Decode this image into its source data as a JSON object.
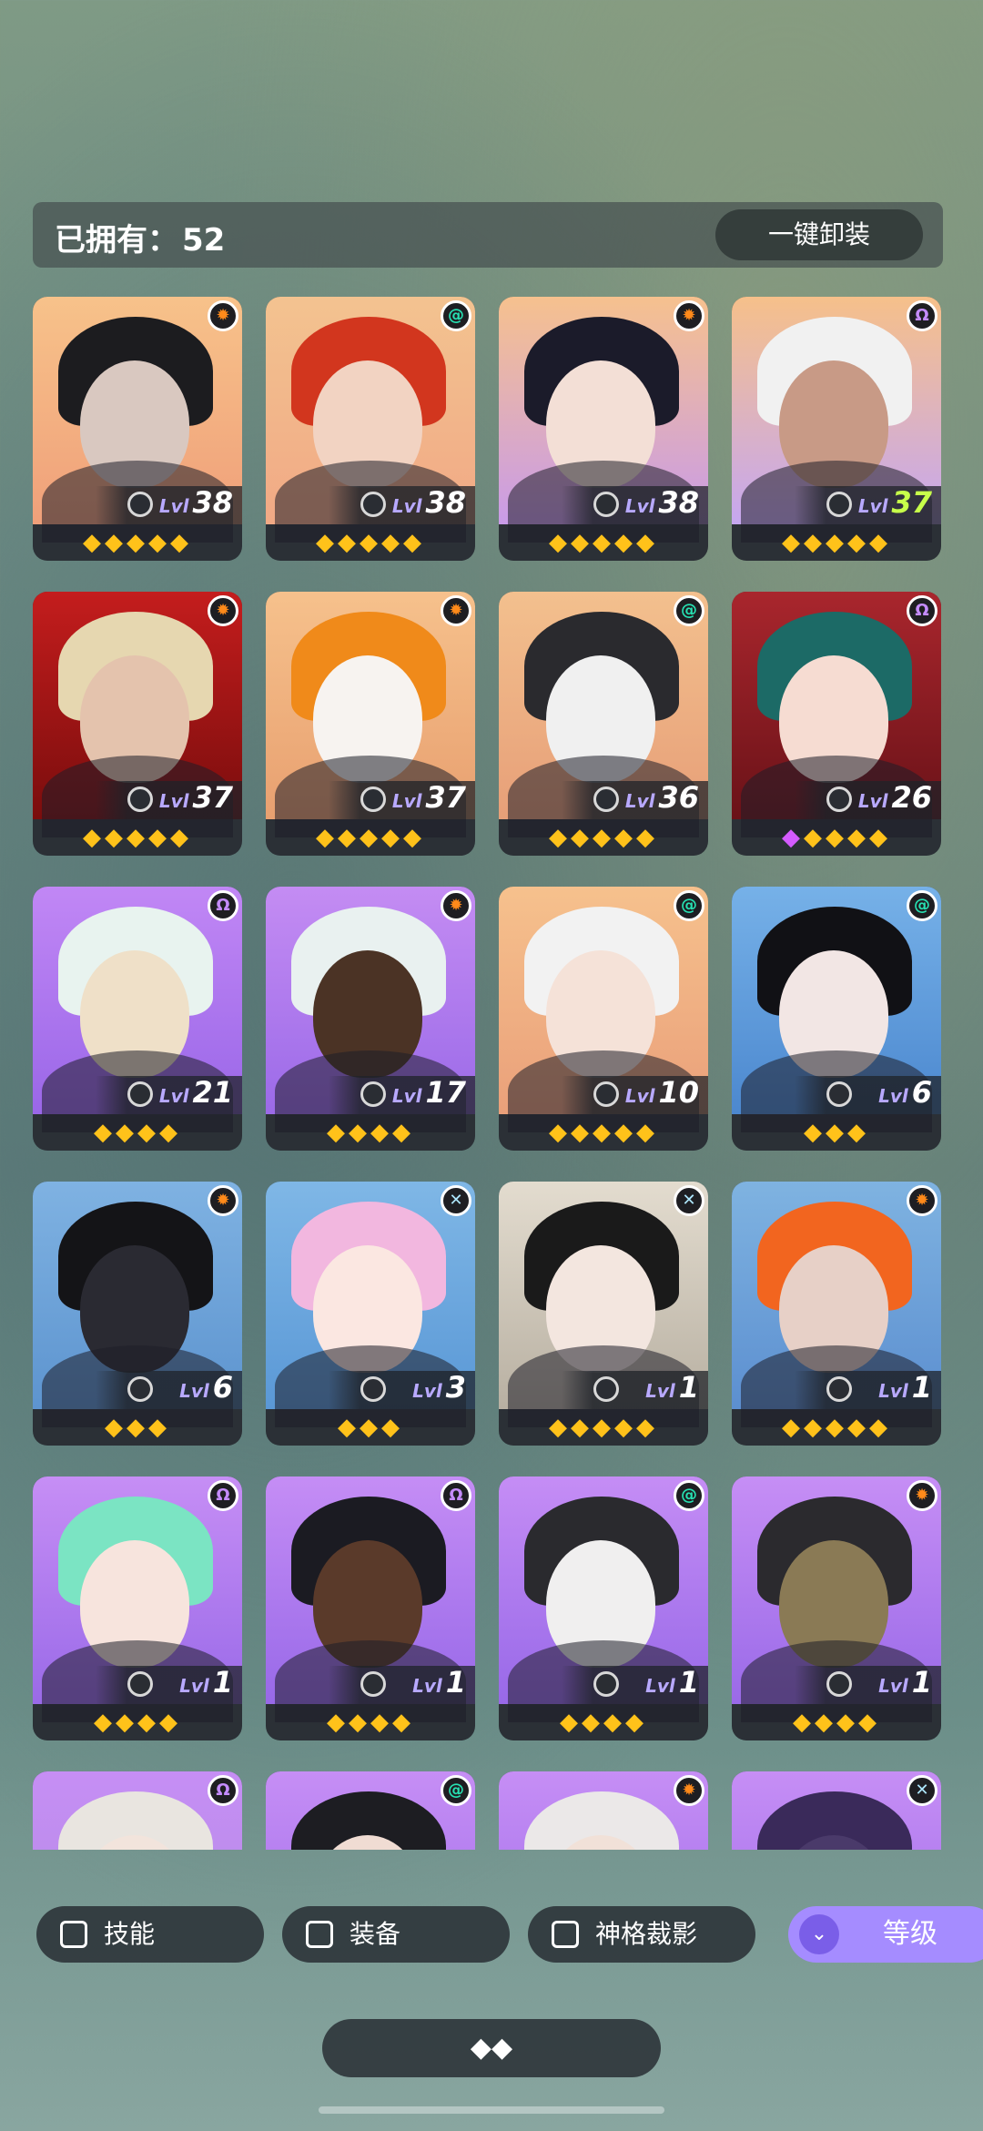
{
  "header": {
    "owned_label": "已拥有：",
    "owned_count": "52",
    "unequip_all": "一键卸装"
  },
  "level_prefix": "Lvl",
  "heroes": [
    {
      "level": "38",
      "stars": 5,
      "faction": "sun",
      "gem": false,
      "bg": [
        "#f7c28a",
        "#f0a07a"
      ],
      "hair": "#1c1c1f",
      "skin": "#d9c8c0"
    },
    {
      "level": "38",
      "stars": 5,
      "faction": "swirl",
      "gem": false,
      "bg": [
        "#f3c390",
        "#f1a985"
      ],
      "hair": "#d2361e",
      "skin": "#f2d3c2"
    },
    {
      "level": "38",
      "stars": 5,
      "faction": "sun",
      "gem": false,
      "bg": [
        "#f6c18e",
        "#c99be8"
      ],
      "hair": "#1b1b2a",
      "skin": "#f3dfd6"
    },
    {
      "level": "37",
      "stars": 5,
      "faction": "omega",
      "gem": false,
      "bg": [
        "#f6c08a",
        "#c6a7f0"
      ],
      "hair": "#f1f1f1",
      "skin": "#c89a86",
      "hi": true
    },
    {
      "level": "37",
      "stars": 5,
      "faction": "sun",
      "gem": false,
      "bg": [
        "#c41d1d",
        "#7a0d0d"
      ],
      "hair": "#e6d7b0",
      "skin": "#e4c3ad"
    },
    {
      "level": "37",
      "stars": 5,
      "faction": "sun",
      "gem": false,
      "bg": [
        "#f6c18c",
        "#e8a070"
      ],
      "hair": "#f08a1a",
      "skin": "#f7f3f0"
    },
    {
      "level": "36",
      "stars": 5,
      "faction": "swirl",
      "gem": false,
      "bg": [
        "#f3c08e",
        "#e79f78"
      ],
      "hair": "#2a2a2e",
      "skin": "#f0f0f0"
    },
    {
      "level": "26",
      "stars": 4,
      "faction": "omega",
      "gem": true,
      "bg": [
        "#a9262d",
        "#6a1218"
      ],
      "hair": "#1c6a66",
      "skin": "#f6dcd2"
    },
    {
      "level": "21",
      "stars": 4,
      "faction": "omega",
      "gem": false,
      "bg": [
        "#c187f5",
        "#9a67e8"
      ],
      "hair": "#e8f3ef",
      "skin": "#efe0c8"
    },
    {
      "level": "17",
      "stars": 4,
      "faction": "sun",
      "gem": false,
      "bg": [
        "#c48cf3",
        "#9b6ae8"
      ],
      "hair": "#e9f1f0",
      "skin": "#4b3325"
    },
    {
      "level": "10",
      "stars": 5,
      "faction": "swirl",
      "gem": false,
      "bg": [
        "#f6c18d",
        "#eaa07a"
      ],
      "hair": "#f2f2f2",
      "skin": "#f5e2d8"
    },
    {
      "level": "6",
      "stars": 3,
      "faction": "swirl",
      "gem": false,
      "bg": [
        "#76b1e8",
        "#4c88cf"
      ],
      "hair": "#111115",
      "skin": "#f2e6e4"
    },
    {
      "level": "6",
      "stars": 3,
      "faction": "sun",
      "gem": false,
      "bg": [
        "#7fb2e2",
        "#5d94cf"
      ],
      "hair": "#141417",
      "skin": "#2a2a32"
    },
    {
      "level": "3",
      "stars": 3,
      "faction": "cross",
      "gem": false,
      "bg": [
        "#7fb7e6",
        "#5a98d6"
      ],
      "hair": "#f2b7df",
      "skin": "#fbe7e1"
    },
    {
      "level": "1",
      "stars": 5,
      "faction": "cross",
      "gem": false,
      "bg": [
        "#e3dccf",
        "#b8b0a2"
      ],
      "hair": "#1a1a1a",
      "skin": "#f3e6df"
    },
    {
      "level": "1",
      "stars": 5,
      "faction": "sun",
      "gem": false,
      "bg": [
        "#7fb3e1",
        "#5c8fd0"
      ],
      "hair": "#f2651f",
      "skin": "#e7d0c7"
    },
    {
      "level": "1",
      "stars": 4,
      "faction": "omega",
      "gem": false,
      "bg": [
        "#c68ef5",
        "#9a6ae8"
      ],
      "hair": "#7be4c3",
      "skin": "#f7e4dd"
    },
    {
      "level": "1",
      "stars": 4,
      "faction": "omega",
      "gem": false,
      "bg": [
        "#c58df5",
        "#9869e8"
      ],
      "hair": "#1b1b22",
      "skin": "#5a3a2a"
    },
    {
      "level": "1",
      "stars": 4,
      "faction": "swirl",
      "gem": false,
      "bg": [
        "#c58df5",
        "#9869e8"
      ],
      "hair": "#2a2a2e",
      "skin": "#f0efef"
    },
    {
      "level": "1",
      "stars": 4,
      "faction": "sun",
      "gem": false,
      "bg": [
        "#c68ef5",
        "#9a6ae8"
      ],
      "hair": "#2b2a2e",
      "skin": "#8a7a55"
    },
    {
      "level": "",
      "stars": 0,
      "faction": "omega",
      "gem": false,
      "bg": [
        "#c68ef5",
        "#b08be0"
      ],
      "hair": "#e9e5e0",
      "skin": "#f2e4dc"
    },
    {
      "level": "",
      "stars": 0,
      "faction": "swirl",
      "gem": false,
      "bg": [
        "#c68ef5",
        "#9a6ae8"
      ],
      "hair": "#1d1d22",
      "skin": "#f0dcd3"
    },
    {
      "level": "",
      "stars": 0,
      "faction": "sun",
      "gem": false,
      "bg": [
        "#c68ef5",
        "#9a6ae8"
      ],
      "hair": "#ebe8e8",
      "skin": "#f1e1d8"
    },
    {
      "level": "",
      "stars": 0,
      "faction": "cross",
      "gem": false,
      "bg": [
        "#c68ef5",
        "#9a6ae8"
      ],
      "hair": "#3a2a5a",
      "skin": "#4a3a6a"
    }
  ],
  "filters": {
    "skill": "技能",
    "equipment": "装备",
    "shadow": "神格裁影",
    "level": "等级"
  },
  "faction_icons": {
    "sun": "sun-faction-icon",
    "swirl": "swirl-faction-icon",
    "omega": "omega-faction-icon",
    "cross": "cross-faction-icon"
  }
}
